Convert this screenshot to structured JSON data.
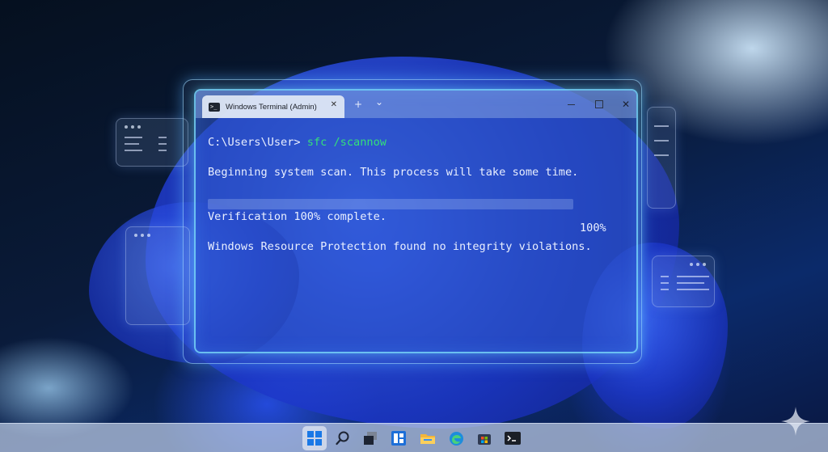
{
  "terminal": {
    "tab_title": "Windows Terminal (Admin)",
    "tab_icon_glyph": ">_",
    "tab_close": "✕",
    "new_tab": "+",
    "tab_dropdown": "⌄",
    "window_close": "✕",
    "prompt": "C:\\Users\\User> ",
    "command": "sfc /scannow",
    "line_begin": "Beginning system scan. This process will take some time.",
    "progress": {
      "value": 1.0,
      "label": "100%"
    },
    "line_verification": "Verification 100% complete.",
    "line_result": "Windows Resource Protection found no integrity violations.",
    "colors": {
      "command": "#34e07a",
      "progress": "#2fd25a",
      "text": "#e9efff"
    }
  },
  "taskbar": {
    "items": [
      "start-icon",
      "search-icon",
      "task-view-icon",
      "widgets-icon",
      "file-explorer-icon",
      "edge-icon",
      "store-icon",
      "terminal-icon"
    ],
    "active": "start-icon"
  }
}
